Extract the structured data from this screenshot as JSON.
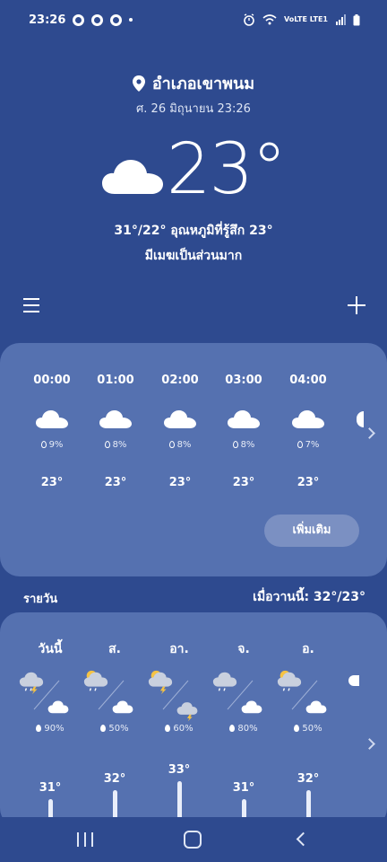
{
  "status_bar": {
    "time": "23:26",
    "network": "VoLTE LTE1"
  },
  "location": {
    "name": "อำเภอเขาพนม",
    "datetime": "ศ. 26 มิถุนายน 23:26"
  },
  "current": {
    "temperature": "23°",
    "minmax_feels": "31°/22° อุณหภูมิที่รู้สึก 23°",
    "condition": "มีเมฆเป็นส่วนมาก"
  },
  "hourly": [
    {
      "time": "00:00",
      "icon": "cloud-icon",
      "precip": "9%",
      "temp": "23°"
    },
    {
      "time": "01:00",
      "icon": "cloud-icon",
      "precip": "8%",
      "temp": "23°"
    },
    {
      "time": "02:00",
      "icon": "cloud-icon",
      "precip": "8%",
      "temp": "23°"
    },
    {
      "time": "03:00",
      "icon": "cloud-icon",
      "precip": "8%",
      "temp": "23°"
    },
    {
      "time": "04:00",
      "icon": "cloud-icon",
      "precip": "7%",
      "temp": "23°"
    }
  ],
  "more_button": "เพิ่มเติม",
  "daily_label": "รายวัน",
  "yesterday": "เมื่อวานนี้: 32°/23°",
  "daily": [
    {
      "day": "วันนี้",
      "am_icon": "thunderstorm-cloud-icon",
      "pm_icon": "cloud-icon",
      "precip": "90%",
      "high": "31°",
      "high_value": 31
    },
    {
      "day": "ส.",
      "am_icon": "sun-cloud-rain-icon",
      "pm_icon": "cloud-icon",
      "precip": "50%",
      "high": "32°",
      "high_value": 32
    },
    {
      "day": "อา.",
      "am_icon": "sun-cloud-thunder-icon",
      "pm_icon": "thunder-cloud-icon",
      "precip": "60%",
      "high": "33°",
      "high_value": 33
    },
    {
      "day": "จ.",
      "am_icon": "rain-cloud-icon",
      "pm_icon": "cloud-icon",
      "precip": "80%",
      "high": "31°",
      "high_value": 31
    },
    {
      "day": "อ.",
      "am_icon": "sun-cloud-rain-icon",
      "pm_icon": "cloud-icon",
      "precip": "50%",
      "high": "32°",
      "high_value": 32
    }
  ]
}
